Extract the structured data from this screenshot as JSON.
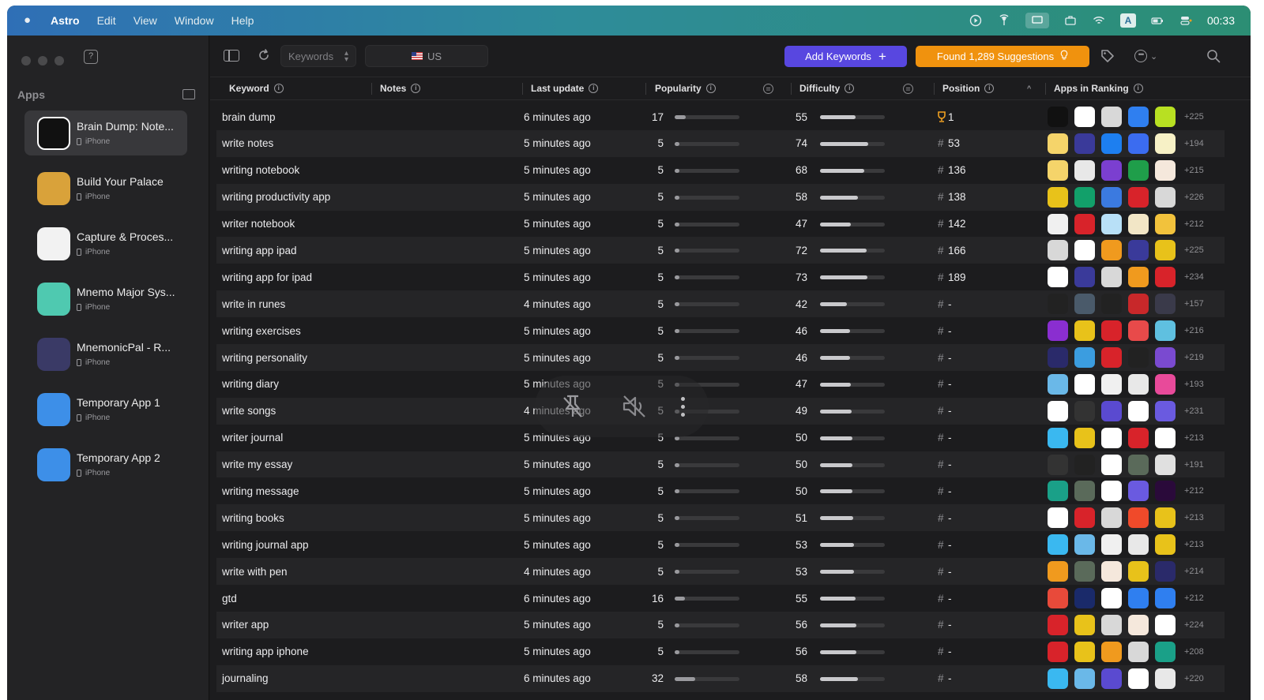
{
  "menubar": {
    "app_name": "Astro",
    "items": [
      "Edit",
      "View",
      "Window",
      "Help"
    ],
    "clock": "00:33"
  },
  "sidebar": {
    "section_label": "Apps",
    "apps": [
      {
        "name": "Brain Dump: Note...",
        "device": "iPhone",
        "active": true,
        "icon": "ink-drop-icon",
        "color": "#111111"
      },
      {
        "name": "Build Your Palace",
        "device": "iPhone",
        "active": false,
        "icon": "palace-icon",
        "color": "#d9a23a"
      },
      {
        "name": "Capture & Proces...",
        "device": "iPhone",
        "active": false,
        "icon": "inbox-tray-icon",
        "color": "#f2f2f2"
      },
      {
        "name": "Mnemo Major Sys...",
        "device": "iPhone",
        "active": false,
        "icon": "brain-icon",
        "color": "#4fc9b0"
      },
      {
        "name": "MnemonicPal - R...",
        "device": "iPhone",
        "active": false,
        "icon": "letter-tiles-icon",
        "color": "#3a3a66"
      },
      {
        "name": "Temporary App 1",
        "device": "iPhone",
        "active": false,
        "icon": "placeholder-app-icon",
        "color": "#3d8fe8"
      },
      {
        "name": "Temporary App 2",
        "device": "iPhone",
        "active": false,
        "icon": "placeholder-app-icon",
        "color": "#3d8fe8"
      }
    ]
  },
  "toolbar": {
    "keywords_select": "Keywords",
    "country": "US",
    "add_keywords_label": "Add Keywords",
    "found_suggestions_label": "Found 1,289 Suggestions"
  },
  "table": {
    "headers": {
      "keyword": "Keyword",
      "notes": "Notes",
      "last_update": "Last update",
      "popularity": "Popularity",
      "difficulty": "Difficulty",
      "position": "Position",
      "apps_in_ranking": "Apps in Ranking"
    },
    "rows": [
      {
        "keyword": "brain dump",
        "updated": "6 minutes ago",
        "popularity": 17,
        "difficulty": 55,
        "position": "1",
        "top": true,
        "more": "+225"
      },
      {
        "keyword": "write notes",
        "updated": "5 minutes ago",
        "popularity": 5,
        "difficulty": 74,
        "position": "53",
        "more": "+194"
      },
      {
        "keyword": "writing notebook",
        "updated": "5 minutes ago",
        "popularity": 5,
        "difficulty": 68,
        "position": "136",
        "more": "+215"
      },
      {
        "keyword": "writing productivity app",
        "updated": "5 minutes ago",
        "popularity": 5,
        "difficulty": 58,
        "position": "138",
        "more": "+226"
      },
      {
        "keyword": "writer notebook",
        "updated": "5 minutes ago",
        "popularity": 5,
        "difficulty": 47,
        "position": "142",
        "more": "+212"
      },
      {
        "keyword": "writing app ipad",
        "updated": "5 minutes ago",
        "popularity": 5,
        "difficulty": 72,
        "position": "166",
        "more": "+225"
      },
      {
        "keyword": "writing app for ipad",
        "updated": "5 minutes ago",
        "popularity": 5,
        "difficulty": 73,
        "position": "189",
        "more": "+234"
      },
      {
        "keyword": "write in runes",
        "updated": "4 minutes ago",
        "popularity": 5,
        "difficulty": 42,
        "position": "-",
        "more": "+157"
      },
      {
        "keyword": "writing exercises",
        "updated": "5 minutes ago",
        "popularity": 5,
        "difficulty": 46,
        "position": "-",
        "more": "+216"
      },
      {
        "keyword": "writing personality",
        "updated": "5 minutes ago",
        "popularity": 5,
        "difficulty": 46,
        "position": "-",
        "more": "+219"
      },
      {
        "keyword": "writing diary",
        "updated": "5 minutes ago",
        "popularity": 5,
        "difficulty": 47,
        "position": "-",
        "more": "+193"
      },
      {
        "keyword": "write songs",
        "updated": "4 minutes ago",
        "popularity": 5,
        "difficulty": 49,
        "position": "-",
        "more": "+231"
      },
      {
        "keyword": "writer journal",
        "updated": "5 minutes ago",
        "popularity": 5,
        "difficulty": 50,
        "position": "-",
        "more": "+213"
      },
      {
        "keyword": "write my essay",
        "updated": "5 minutes ago",
        "popularity": 5,
        "difficulty": 50,
        "position": "-",
        "more": "+191"
      },
      {
        "keyword": "writing message",
        "updated": "5 minutes ago",
        "popularity": 5,
        "difficulty": 50,
        "position": "-",
        "more": "+212"
      },
      {
        "keyword": "writing books",
        "updated": "5 minutes ago",
        "popularity": 5,
        "difficulty": 51,
        "position": "-",
        "more": "+213"
      },
      {
        "keyword": "writing journal app",
        "updated": "5 minutes ago",
        "popularity": 5,
        "difficulty": 53,
        "position": "-",
        "more": "+213"
      },
      {
        "keyword": "write with pen",
        "updated": "4 minutes ago",
        "popularity": 5,
        "difficulty": 53,
        "position": "-",
        "more": "+214"
      },
      {
        "keyword": "gtd",
        "updated": "6 minutes ago",
        "popularity": 16,
        "difficulty": 55,
        "position": "-",
        "more": "+212"
      },
      {
        "keyword": "writer app",
        "updated": "5 minutes ago",
        "popularity": 5,
        "difficulty": 56,
        "position": "-",
        "more": "+224"
      },
      {
        "keyword": "writing app iphone",
        "updated": "5 minutes ago",
        "popularity": 5,
        "difficulty": 56,
        "position": "-",
        "more": "+208"
      },
      {
        "keyword": "journaling",
        "updated": "6 minutes ago",
        "popularity": 32,
        "difficulty": 58,
        "position": "-",
        "more": "+220"
      }
    ],
    "ranking_icon_colors": [
      [
        "#111111",
        "#ffffff",
        "#d8d8d8",
        "#2f7ff0",
        "#b8e022"
      ],
      [
        "#f5d46a",
        "#3a3a9a",
        "#1d7ff0",
        "#3b6cf0",
        "#f7f1c6"
      ],
      [
        "#f5d46a",
        "#e8e8e8",
        "#7b3fd0",
        "#1f9e4a",
        "#f5e8dc"
      ],
      [
        "#e8c21a",
        "#12a06a",
        "#3b7ae0",
        "#d8232a",
        "#d8d8d8"
      ],
      [
        "#f0f0f0",
        "#d8232a",
        "#b8e0f7",
        "#f2e6c6",
        "#f2c23c"
      ],
      [
        "#d8d8d8",
        "#ffffff",
        "#f09a1e",
        "#3a3a9a",
        "#e8c21a"
      ],
      [
        "#ffffff",
        "#3a3a9a",
        "#d8d8d8",
        "#f09a1e",
        "#d8232a"
      ],
      [
        "#222222",
        "#4a5a6a",
        "#222222",
        "#c8282a",
        "#3a3a4a"
      ],
      [
        "#8a2ed0",
        "#e8c21a",
        "#d8232a",
        "#e84a4a",
        "#5fc0e0"
      ],
      [
        "#2a2a6a",
        "#3b9de0",
        "#d8232a",
        "#222222",
        "#7a4ad0"
      ],
      [
        "#6ab8e8",
        "#ffffff",
        "#f0f0f0",
        "#e8e8e8",
        "#e84a9a"
      ],
      [
        "#ffffff",
        "#333333",
        "#5a4ad0",
        "#ffffff",
        "#6a5ae0"
      ],
      [
        "#3ab8f0",
        "#e8c21a",
        "#ffffff",
        "#d8232a",
        "#ffffff"
      ],
      [
        "#333333",
        "#222222",
        "#ffffff",
        "#5a6a5a",
        "#e0e0e0"
      ],
      [
        "#1aa088",
        "#5a6a5a",
        "#ffffff",
        "#6a5ae0",
        "#2a0a3a"
      ],
      [
        "#ffffff",
        "#d8232a",
        "#d8d8d8",
        "#f04a2a",
        "#e8c21a"
      ],
      [
        "#3ab8f0",
        "#6ab8e8",
        "#f0f0f0",
        "#e8e8e8",
        "#e8c21a"
      ],
      [
        "#f09a1e",
        "#5a6a5a",
        "#f5e8dc",
        "#e8c21a",
        "#2a2a6a"
      ],
      [
        "#e84a3a",
        "#1a2a6a",
        "#ffffff",
        "#2f7ff0",
        "#2f7ff0"
      ],
      [
        "#d8232a",
        "#e8c21a",
        "#d8d8d8",
        "#f5e8dc",
        "#ffffff"
      ],
      [
        "#d8232a",
        "#e8c21a",
        "#f09a1e",
        "#d8d8d8",
        "#1aa088"
      ],
      [
        "#3ab8f0",
        "#6ab8e8",
        "#5a4ad0",
        "#ffffff",
        "#e8e8e8"
      ]
    ]
  }
}
